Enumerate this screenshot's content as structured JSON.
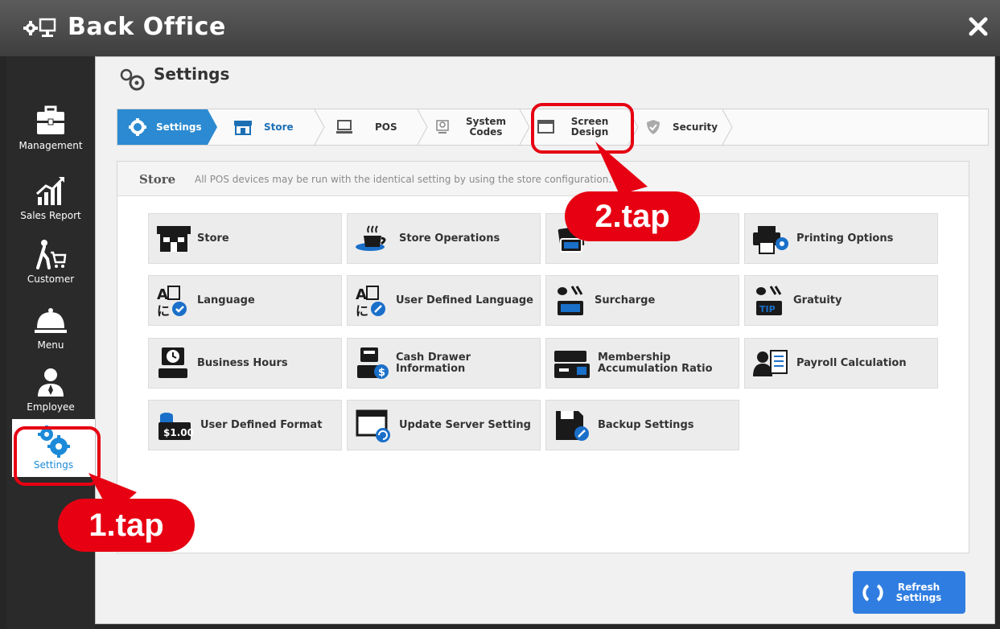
{
  "window": {
    "title": "Back Office",
    "app_icon": "settings-monitor-icon",
    "close_icon": "close-icon"
  },
  "sidebar": {
    "items": [
      {
        "label": "Management",
        "icon": "briefcase-icon"
      },
      {
        "label": "Sales Report",
        "icon": "chart-icon"
      },
      {
        "label": "Customer",
        "icon": "shopping-cart-icon"
      },
      {
        "label": "Menu",
        "icon": "cloche-icon"
      },
      {
        "label": "Employee",
        "icon": "person-icon"
      },
      {
        "label": "Settings",
        "icon": "gears-icon",
        "active": true
      }
    ]
  },
  "page": {
    "title": "Settings"
  },
  "tabs": [
    {
      "label": "Settings",
      "active": true
    },
    {
      "label": "Store"
    },
    {
      "label": "POS"
    },
    {
      "label": "System Codes"
    },
    {
      "label": "Screen Design"
    },
    {
      "label": "Security"
    }
  ],
  "panel": {
    "title": "Store",
    "description": "All POS devices may be run with the identical setting by using the store configuration."
  },
  "tiles": [
    {
      "label": "Store",
      "icon": "store-icon"
    },
    {
      "label": "Store Operations",
      "icon": "coffee-cup-icon"
    },
    {
      "label": "",
      "icon": "money-icon"
    },
    {
      "label": "Printing Options",
      "icon": "printer-icon"
    },
    {
      "label": "Language",
      "icon": "language-icon"
    },
    {
      "label": "User Defined Language",
      "icon": "language-edit-icon"
    },
    {
      "label": "Surcharge",
      "icon": "surcharge-icon"
    },
    {
      "label": "Gratuity",
      "icon": "tip-icon"
    },
    {
      "label": "Business Hours",
      "icon": "clock-register-icon"
    },
    {
      "label": "Cash Drawer Information",
      "icon": "cash-drawer-icon"
    },
    {
      "label": "Membership Accumulation Ratio",
      "icon": "membership-card-icon"
    },
    {
      "label": "Payroll Calculation",
      "icon": "payroll-icon"
    },
    {
      "label": "User Defined Format",
      "icon": "receipt-format-icon"
    },
    {
      "label": "Update Server Setting",
      "icon": "update-server-icon"
    },
    {
      "label": "Backup Settings",
      "icon": "backup-icon"
    }
  ],
  "buttons": {
    "refresh": "Refresh Settings"
  },
  "annotations": {
    "step1": "1.tap",
    "step2": "2.tap"
  },
  "colors": {
    "accent": "#2b8ad1",
    "callout": "#e60012"
  }
}
